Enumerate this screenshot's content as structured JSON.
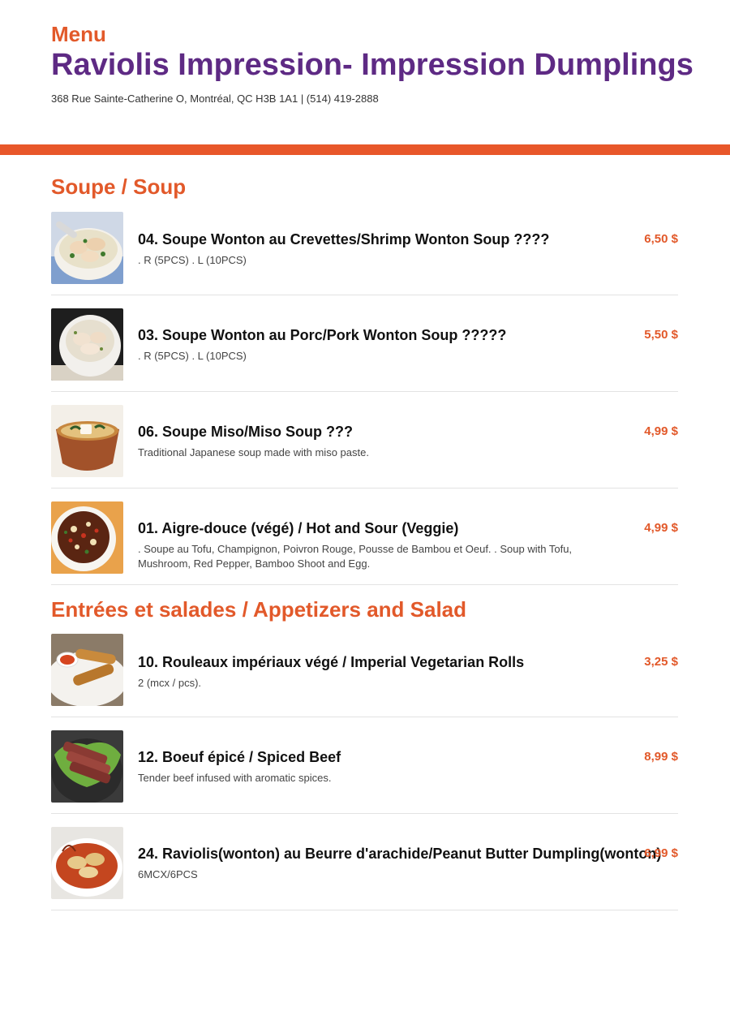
{
  "header": {
    "menu_label": "Menu",
    "restaurant_name": "Raviolis Impression- Impression Dumplings",
    "address": "368 Rue Sainte-Catherine O, Montréal, QC H3B 1A1 | (514) 419-2888"
  },
  "colors": {
    "accent": "#e2592a",
    "brand": "#5e2a84",
    "bar": "#e8572a"
  },
  "sections": [
    {
      "title": "Soupe / Soup",
      "items": [
        {
          "name": "04. Soupe Wonton au Crevettes/Shrimp Wonton Soup ????",
          "price": "6,50 $",
          "description": ". R (5PCS) . L (10PCS)",
          "image": "shrimp-wonton-soup-photo"
        },
        {
          "name": "03. Soupe Wonton au Porc/Pork Wonton Soup ?????",
          "price": "5,50 $",
          "description": ". R (5PCS) . L (10PCS)",
          "image": "pork-wonton-soup-photo"
        },
        {
          "name": "06. Soupe Miso/Miso Soup ???",
          "price": "4,99 $",
          "description": "Traditional Japanese soup made with miso paste.",
          "image": "miso-soup-photo"
        },
        {
          "name": "01. Aigre-douce (végé) / Hot and Sour (Veggie)",
          "price": "4,99 $",
          "description": ". Soupe au Tofu, Champignon, Poivron Rouge, Pousse de Bambou et Oeuf. . Soup with Tofu, Mushroom, Red Pepper, Bamboo Shoot and Egg.",
          "image": "hot-and-sour-soup-photo"
        }
      ]
    },
    {
      "title": "Entrées et salades / Appetizers and Salad",
      "items": [
        {
          "name": "10. Rouleaux impériaux végé / Imperial Vegetarian Rolls",
          "price": "3,25 $",
          "description": "2 (mcx / pcs).",
          "image": "imperial-rolls-photo"
        },
        {
          "name": "12. Boeuf épicé / Spiced Beef",
          "price": "8,99 $",
          "description": "Tender beef infused with aromatic spices.",
          "image": "spiced-beef-photo"
        },
        {
          "name": "24. Raviolis(wonton) au Beurre d'arachide/Peanut Butter Dumpling(wonton)",
          "price": "6,99 $",
          "description": "6MCX/6PCS",
          "image": "peanut-butter-dumpling-photo"
        }
      ]
    }
  ]
}
